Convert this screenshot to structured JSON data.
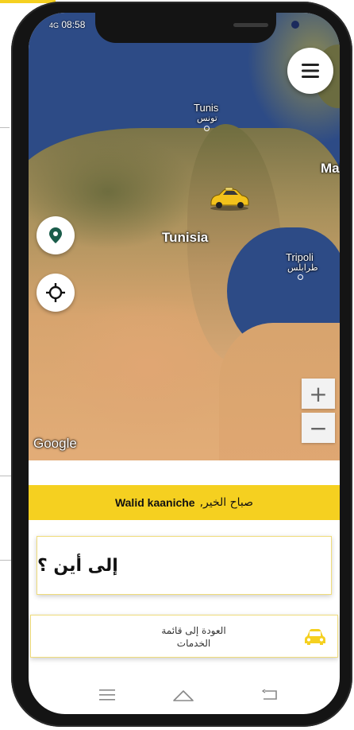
{
  "status_bar": {
    "signal": "4G",
    "time": "08:58"
  },
  "map": {
    "labels": {
      "tunis": "Tunis",
      "tunis_ar": "تونس",
      "tunisia": "Tunisia",
      "tripoli": "Tripoli",
      "tripoli_ar": "طرابلس",
      "mal": "Mal"
    },
    "attribution": "Google",
    "zoom_in": "+",
    "zoom_out": "−"
  },
  "greeting": {
    "text": "صباح الخير,",
    "name": "Walid kaaniche"
  },
  "destination": {
    "label": "إلى أين ؟"
  },
  "services": {
    "label_line1": "العودة إلى قائمة",
    "label_line2": "الخدمات"
  },
  "colors": {
    "accent": "#f5d020",
    "pin": "#1a5c4a"
  },
  "icons": [
    "menu-icon",
    "location-pin-icon",
    "crosshair-icon",
    "car-icon",
    "nav-menu-icon",
    "nav-home-icon",
    "nav-back-icon"
  ]
}
